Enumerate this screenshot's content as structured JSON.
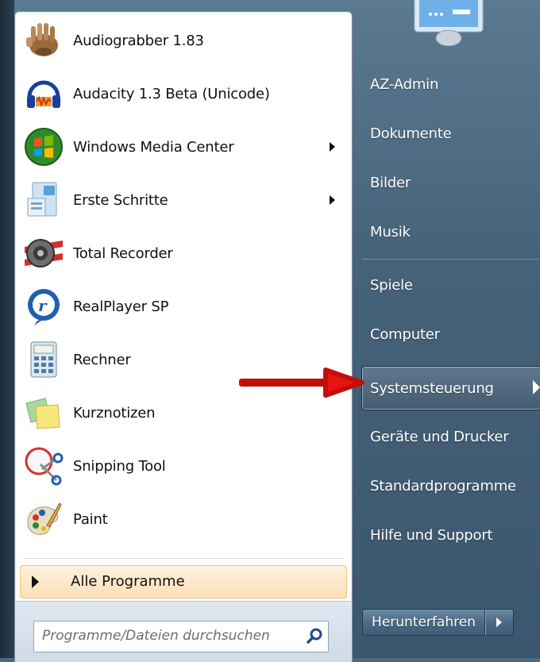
{
  "programs": [
    {
      "label": "Audiograbber 1.83",
      "icon": "audiograbber-icon",
      "submenu": false
    },
    {
      "label": "Audacity 1.3 Beta (Unicode)",
      "icon": "audacity-icon",
      "submenu": false
    },
    {
      "label": "Windows Media Center",
      "icon": "media-center-icon",
      "submenu": true
    },
    {
      "label": "Erste Schritte",
      "icon": "getting-started-icon",
      "submenu": true
    },
    {
      "label": "Total Recorder",
      "icon": "total-recorder-icon",
      "submenu": false
    },
    {
      "label": "RealPlayer SP",
      "icon": "realplayer-icon",
      "submenu": false
    },
    {
      "label": "Rechner",
      "icon": "calculator-icon",
      "submenu": false
    },
    {
      "label": "Kurznotizen",
      "icon": "sticky-notes-icon",
      "submenu": false
    },
    {
      "label": "Snipping Tool",
      "icon": "snipping-tool-icon",
      "submenu": false
    },
    {
      "label": "Paint",
      "icon": "paint-icon",
      "submenu": false
    }
  ],
  "all_programs": {
    "label": "Alle Programme"
  },
  "search": {
    "placeholder": "Programme/Dateien durchsuchen",
    "value": ""
  },
  "right_items": [
    {
      "label": "AZ-Admin"
    },
    {
      "label": "Dokumente"
    },
    {
      "label": "Bilder"
    },
    {
      "label": "Musik"
    },
    {
      "label": "Spiele"
    },
    {
      "label": "Computer"
    },
    {
      "label": "Systemsteuerung",
      "highlighted": true
    },
    {
      "label": "Geräte und Drucker"
    },
    {
      "label": "Standardprogramme"
    },
    {
      "label": "Hilfe und Support"
    }
  ],
  "shutdown": {
    "label": "Herunterfahren"
  },
  "colors": {
    "annotation_arrow": "#e8140f",
    "highlight_border": "#1a2530",
    "all_programs_bg": "#fbe0b8"
  }
}
